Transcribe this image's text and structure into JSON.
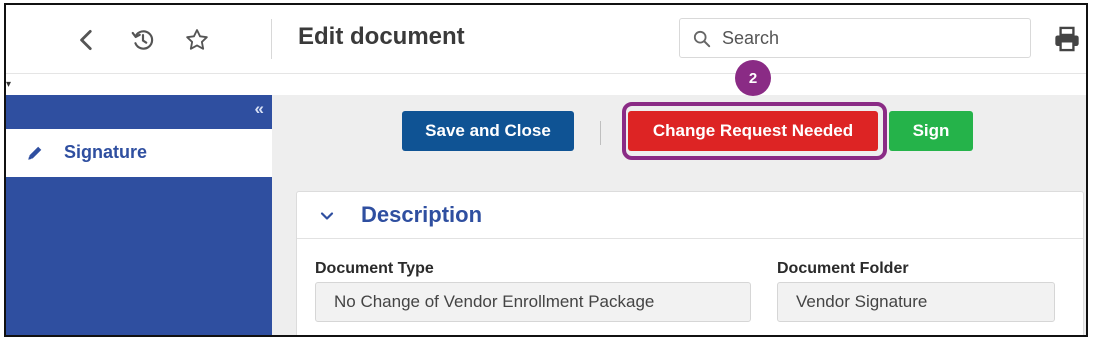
{
  "header": {
    "title": "Edit document",
    "search_placeholder": "Search",
    "icons": [
      "chevron-left-icon",
      "history-icon",
      "star-icon",
      "search-icon",
      "print-icon"
    ]
  },
  "sidebar": {
    "collapse_label": "«",
    "items": [
      {
        "label": "Signature",
        "icon": "pencil-icon"
      }
    ]
  },
  "toolbar": {
    "save_label": "Save and Close",
    "change_label": "Change Request Needed",
    "sign_label": "Sign",
    "step_badge": "2"
  },
  "section": {
    "title": "Description",
    "fields": [
      {
        "label": "Document Type",
        "value": "No Change of Vendor Enrollment Package"
      },
      {
        "label": "Document Folder",
        "value": "Vendor Signature"
      }
    ]
  },
  "colors": {
    "sidebar": "#2f4fa0",
    "save": "#0f5394",
    "change": "#dd2424",
    "sign": "#25b34a",
    "highlight": "#8a2b85"
  }
}
